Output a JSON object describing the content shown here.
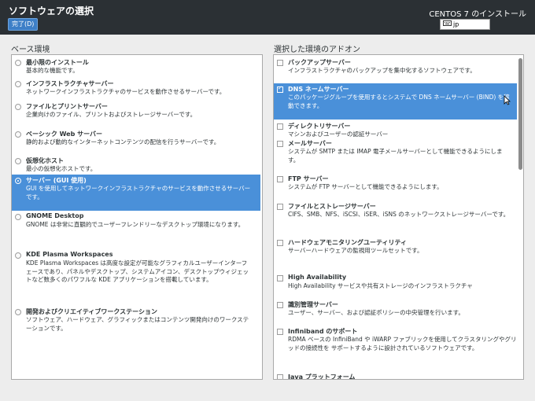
{
  "header": {
    "title": "ソフトウェアの選択",
    "done_button": "完了(D)",
    "product": "CENTOS 7 のインストール",
    "keyboard_layout": "jp"
  },
  "environments": {
    "heading": "ベース環境",
    "items": [
      {
        "name": "最小限のインストール",
        "desc": "基本的な機能です。",
        "selected": false
      },
      {
        "name": "インフラストラクチャサーバー",
        "desc": "ネットワークインフラストラクチャのサービスを動作させるサーバーです。",
        "selected": false
      },
      {
        "name": "ファイルとプリントサーバー",
        "desc": "企業向けのファイル、プリントおよびストレージサーバーです。",
        "selected": false
      },
      {
        "name": "ベーシック Web サーバー",
        "desc": "静的および動的なインターネットコンテンツの配信を行うサーバーです。",
        "selected": false
      },
      {
        "name": "仮想化ホスト",
        "desc": "最小の仮想化ホストです。",
        "selected": false
      },
      {
        "name": "サーバー (GUI 使用)",
        "desc": "GUI を使用してネットワークインフラストラクチャのサービスを動作させるサーバー\nです。",
        "selected": true
      },
      {
        "name": "GNOME Desktop",
        "desc": "GNOME は非常に直観的でユーザーフレンドリーなデスクトップ環境になります。",
        "selected": false
      },
      {
        "name": "KDE Plasma Workspaces",
        "desc": "KDE Plasma Workspaces は高度な設定が可能なグラフィカルユーザーインターフ\nェースであり、パネルやデスクトップ、システムアイコン、デスクトップウィジェッ\nトなど数多くのパワフルな KDE アプリケーションを搭載しています。",
        "selected": false
      },
      {
        "name": "開発およびクリエイティブワークステーション",
        "desc": "ソフトウェア、ハードウェア、グラフィックまたはコンテンツ開発向けのワークステ\nーションです。",
        "selected": false
      }
    ]
  },
  "addons": {
    "heading": "選択した環境のアドオン",
    "items": [
      {
        "name": "バックアップサーバー",
        "desc": "インフラストラクチャのバックアップを集中化するソフトウェアです。",
        "selected": false
      },
      {
        "name": "DNS ネームサーバー",
        "desc": "このパッケージグループを使用するとシステムで DNS ネームサーバー (BIND) を稼\n動できます。",
        "selected": true
      },
      {
        "name": "ディレクトリサーバー",
        "desc": "マシンおよびユーザーの認証サーバー",
        "selected": false
      },
      {
        "name": "メールサーバー",
        "desc": "システムが SMTP または IMAP 電子メールサーバーとして機能できるようにしま\nす。",
        "selected": false
      },
      {
        "name": "FTP サーバー",
        "desc": "システムが FTP サーバーとして機能できるようにします。",
        "selected": false
      },
      {
        "name": "ファイルとストレージサーバー",
        "desc": "CIFS、SMB、NFS、iSCSI、iSER、iSNS のネットワークストレージサーバーです。",
        "selected": false
      },
      {
        "name": "ハードウェアモニタリングユーティリティ",
        "desc": "サーバーハードウェアの監視用ツールセットです。",
        "selected": false
      },
      {
        "name": "High Availability",
        "desc": "High Availability サービスや共有ストレージのインフラストラクチャ",
        "selected": false
      },
      {
        "name": "識別管理サーバー",
        "desc": "ユーザー、サーバー、および認証ポリシーの中央管理を行います。",
        "selected": false
      },
      {
        "name": "Infiniband のサポート",
        "desc": "RDMA ベースの InfiniBand や iWARP ファブリックを使用してクラスタリングやグリ\nッドの接続性を サポートするように設計されているソフトウェアです。",
        "selected": false
      },
      {
        "name": "Java プラットフォーム",
        "desc": "",
        "selected": false
      }
    ]
  },
  "colors": {
    "header_bg": "#2b3034",
    "selection": "#4a90d9",
    "done_button": "#3d7fc7"
  }
}
